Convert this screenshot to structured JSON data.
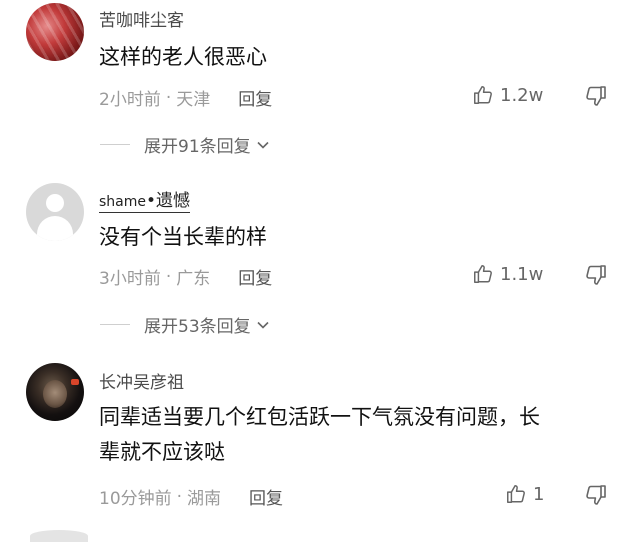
{
  "comments": [
    {
      "username": "苦咖啡尘客",
      "text": "这样的老人很恶心",
      "time": "2小时前",
      "location": "天津",
      "reply_label": "回复",
      "likes": "1.2w",
      "expand_label": "展开91条回复"
    },
    {
      "username": "shame",
      "username_badge": "遗憾",
      "text": "没有个当长辈的样",
      "time": "3小时前",
      "location": "广东",
      "reply_label": "回复",
      "likes": "1.1w",
      "expand_label": "展开53条回复"
    },
    {
      "username": "长冲吴彦祖",
      "text_line1": "同辈适当要几个红包活跃一下气氛没有问题，长",
      "text_line2": "辈就不应该哒",
      "time": "10分钟前",
      "location": "湖南",
      "reply_label": "回复",
      "likes": "1"
    }
  ],
  "separator": "·",
  "colors": {
    "meta_text": "#9a9a9a",
    "body_text": "#111111",
    "icon": "#666666"
  },
  "icons": [
    "thumb-up-icon",
    "thumb-down-icon",
    "chevron-down-icon"
  ]
}
